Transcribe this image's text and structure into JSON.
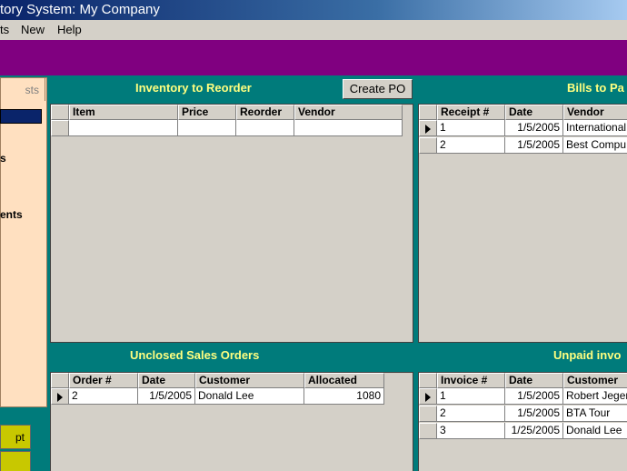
{
  "window": {
    "title": "tory System: My Company"
  },
  "menu": {
    "item1": "ts",
    "item2": "New",
    "item3": "Help"
  },
  "nav": {
    "tab_label": "sts",
    "items": [
      "s",
      "ents"
    ],
    "buttons": [
      "pt",
      ""
    ]
  },
  "reorder": {
    "title": "Inventory to Reorder",
    "create_po": "Create PO",
    "columns": [
      "Item",
      "Price",
      "Reorder",
      "Vendor"
    ],
    "rows": [
      [
        "",
        "",
        "",
        ""
      ]
    ]
  },
  "bills": {
    "title": "Bills to Pa",
    "columns": [
      "Receipt #",
      "Date",
      "Vendor"
    ],
    "rows": [
      [
        "1",
        "1/5/2005",
        "International"
      ],
      [
        "2",
        "1/5/2005",
        "Best Compu"
      ]
    ]
  },
  "sales": {
    "title": "Unclosed Sales Orders",
    "columns": [
      "Order #",
      "Date",
      "Customer",
      "Allocated"
    ],
    "rows": [
      [
        "2",
        "1/5/2005",
        "Donald Lee",
        "1080"
      ]
    ]
  },
  "invoices": {
    "title": "Unpaid invo",
    "columns": [
      "Invoice #",
      "Date",
      "Customer"
    ],
    "rows": [
      [
        "1",
        "1/5/2005",
        "Robert Jeger"
      ],
      [
        "2",
        "1/5/2005",
        "BTA Tour"
      ],
      [
        "3",
        "1/25/2005",
        "Donald Lee"
      ]
    ]
  }
}
